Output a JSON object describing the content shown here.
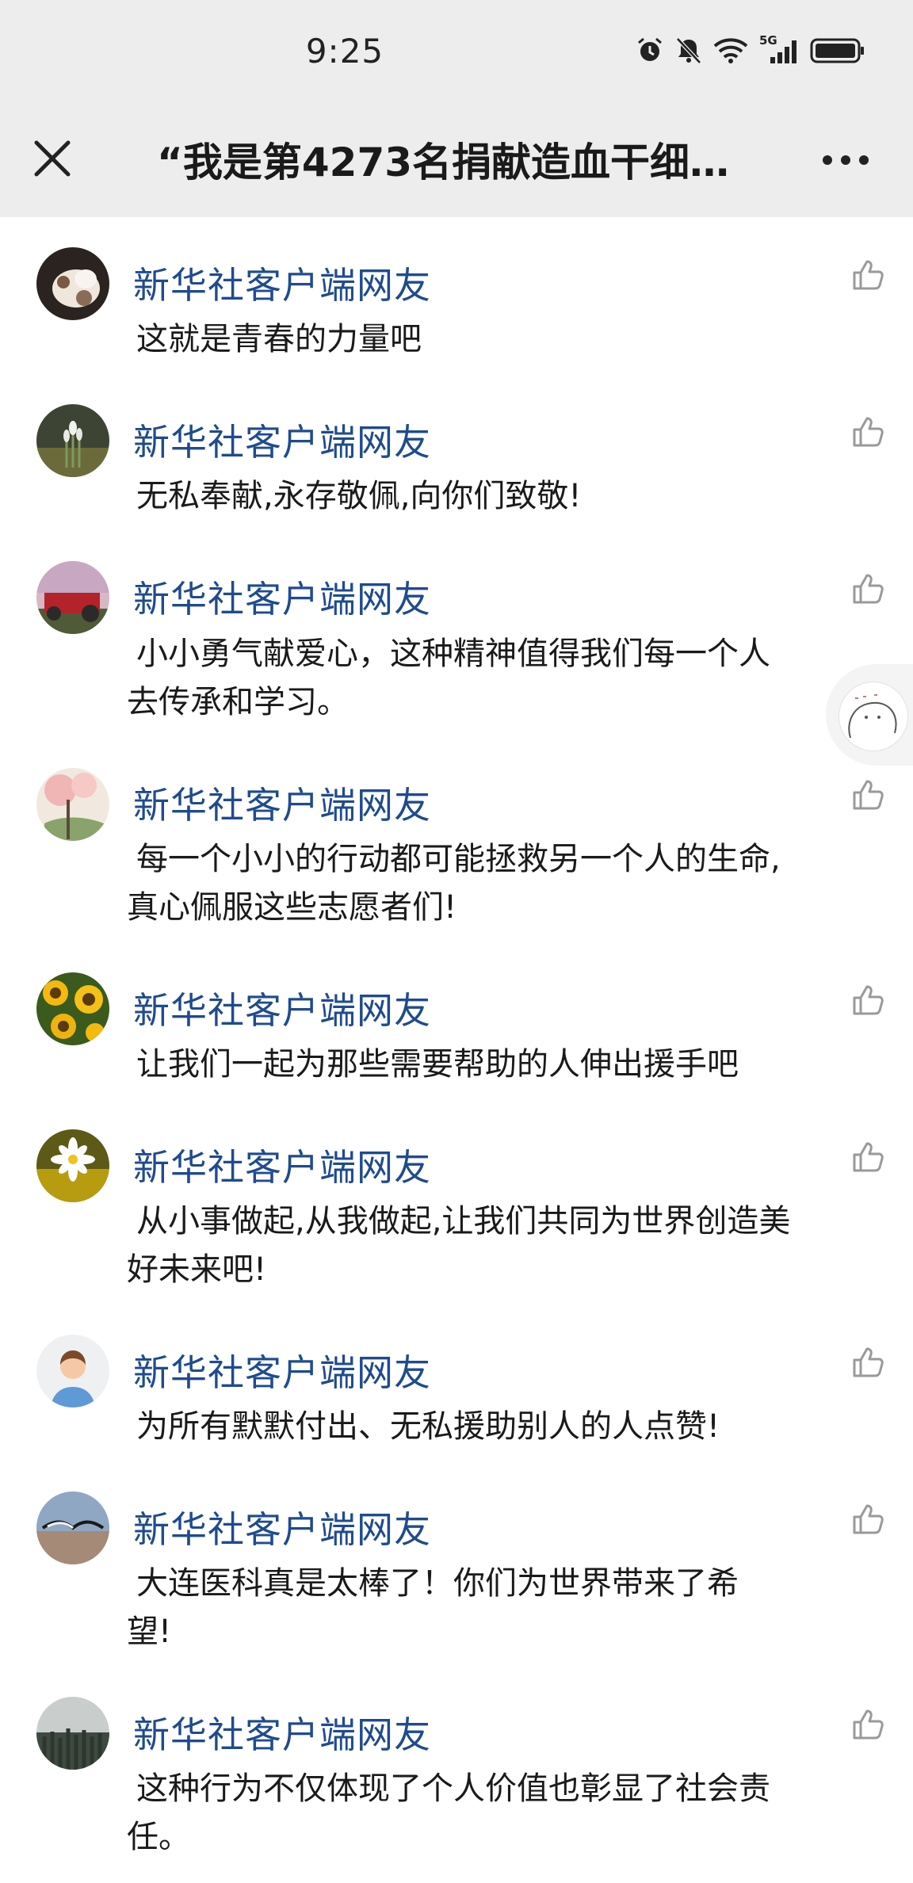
{
  "status_bar": {
    "time": "9:25",
    "icons": [
      "alarm-icon",
      "mute-bell-icon",
      "wifi-icon",
      "5g-signal-icon",
      "battery-icon"
    ],
    "network_label": "5G"
  },
  "nav": {
    "title": "“我是第4273名捐献造血干细…",
    "close_icon": "close-icon",
    "more_icon": "more-icon"
  },
  "colors": {
    "header_bg": "#ededed",
    "username": "#1f4b8e",
    "text": "#1a1a1a",
    "like_icon": "#9a9a9a"
  },
  "comments": [
    {
      "user": "新华社客户端网友",
      "text": "这就是青春的力量吧",
      "avatar": "kitten-avatar"
    },
    {
      "user": "新华社客户端网友",
      "text": "无私奉献,永存敬佩,向你们致敬!",
      "avatar": "snowdrop-avatar"
    },
    {
      "user": "新华社客户端网友",
      "text": "小小勇气献爱心，这种精神值得我们每一个人去传承和学习。",
      "avatar": "tractor-avatar"
    },
    {
      "user": "新华社客户端网友",
      "text": "每一个小小的行动都可能拯救另一个人的生命,真心佩服这些志愿者们!",
      "avatar": "blossom-painting-avatar"
    },
    {
      "user": "新华社客户端网友",
      "text": "让我们一起为那些需要帮助的人伸出援手吧",
      "avatar": "sunflower-avatar"
    },
    {
      "user": "新华社客户端网友",
      "text": "从小事做起,从我做起,让我们共同为世界创造美好未来吧!",
      "avatar": "daisy-avatar"
    },
    {
      "user": "新华社客户端网友",
      "text": "为所有默默付出、无私援助别人的人点赞!",
      "avatar": "default-person-avatar"
    },
    {
      "user": "新华社客户端网友",
      "text": "大连医科真是太棒了！你们为世界带来了希望!",
      "avatar": "seagull-avatar"
    },
    {
      "user": "新华社客户端网友",
      "text": "这种行为不仅体现了个人价值也彰显了社会责任。",
      "avatar": "misty-forest-avatar"
    }
  ]
}
